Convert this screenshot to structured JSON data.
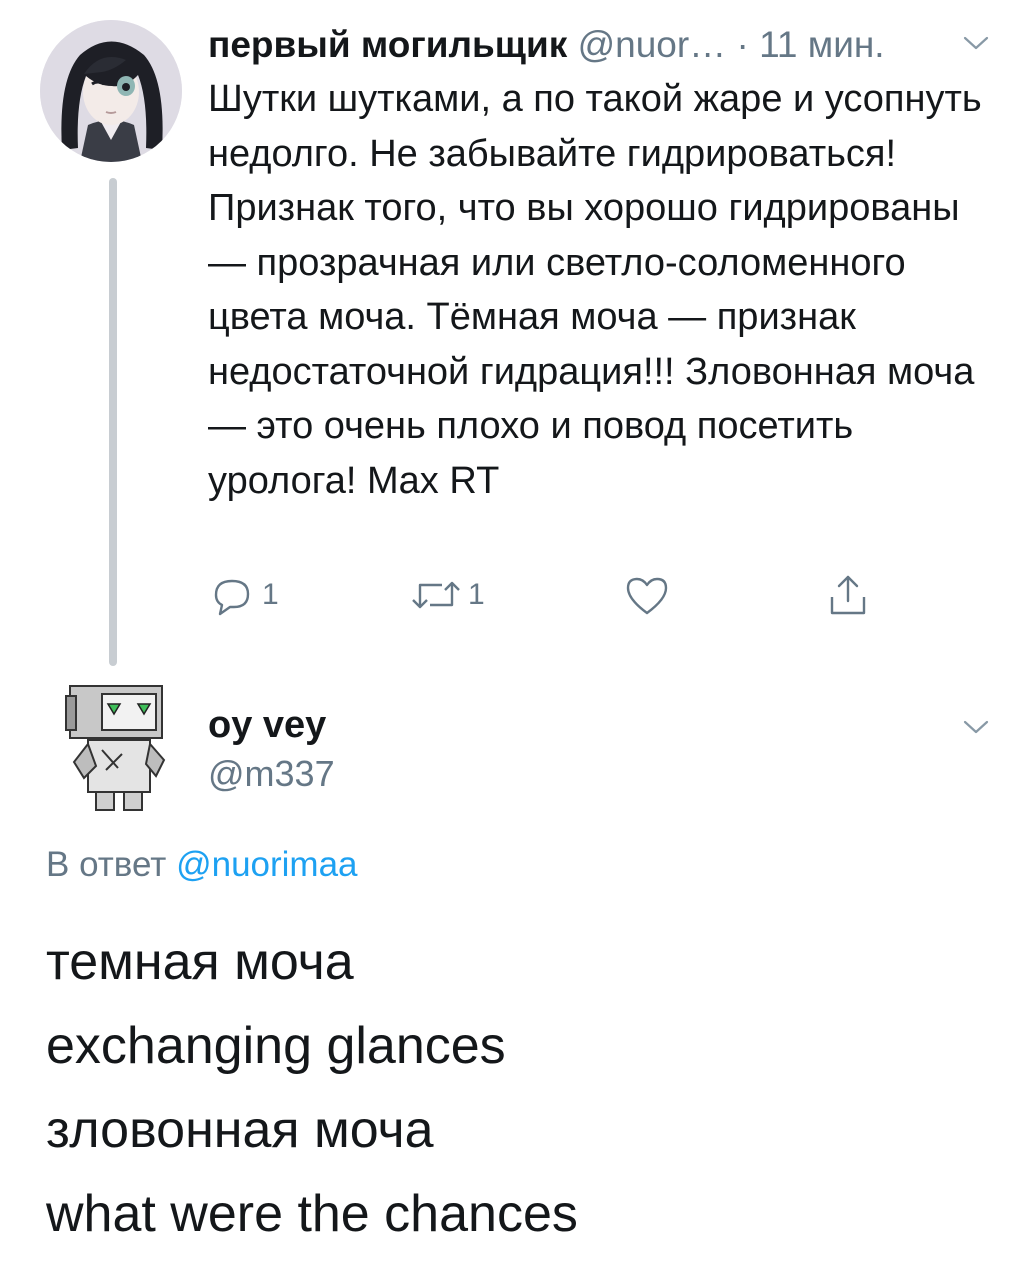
{
  "tweet1": {
    "name": "первый могильщик",
    "handle": "@nuor…",
    "separator": "·",
    "time": "11 мин.",
    "text": "Шутки шутками, а по такой жаре и усопнуть недолго. Не забывайте гидрироваться! Признак того, что вы хорошо гидрированы — прозрачная или светло-соломенного цвета моча. Тёмная моча — признак недостаточной гидрация!!! Зловонная моча — это очень плохо и повод посетить уролога! Max RT",
    "replies": "1",
    "retweets": "1",
    "icons": [
      "reply-icon",
      "retweet-icon",
      "like-icon",
      "share-icon",
      "chevron-down-icon"
    ]
  },
  "tweet2": {
    "name": "oy vey",
    "handle": "@m337",
    "reply_prefix": "В ответ",
    "reply_mention": "@nuorimaa",
    "lines": [
      "темная моча",
      "exchanging glances",
      "зловонная моча",
      "what were the chances"
    ]
  },
  "colors": {
    "text": "#14171a",
    "secondary": "#657786",
    "link": "#1da1f2",
    "thread_line": "#c8cdd2"
  }
}
